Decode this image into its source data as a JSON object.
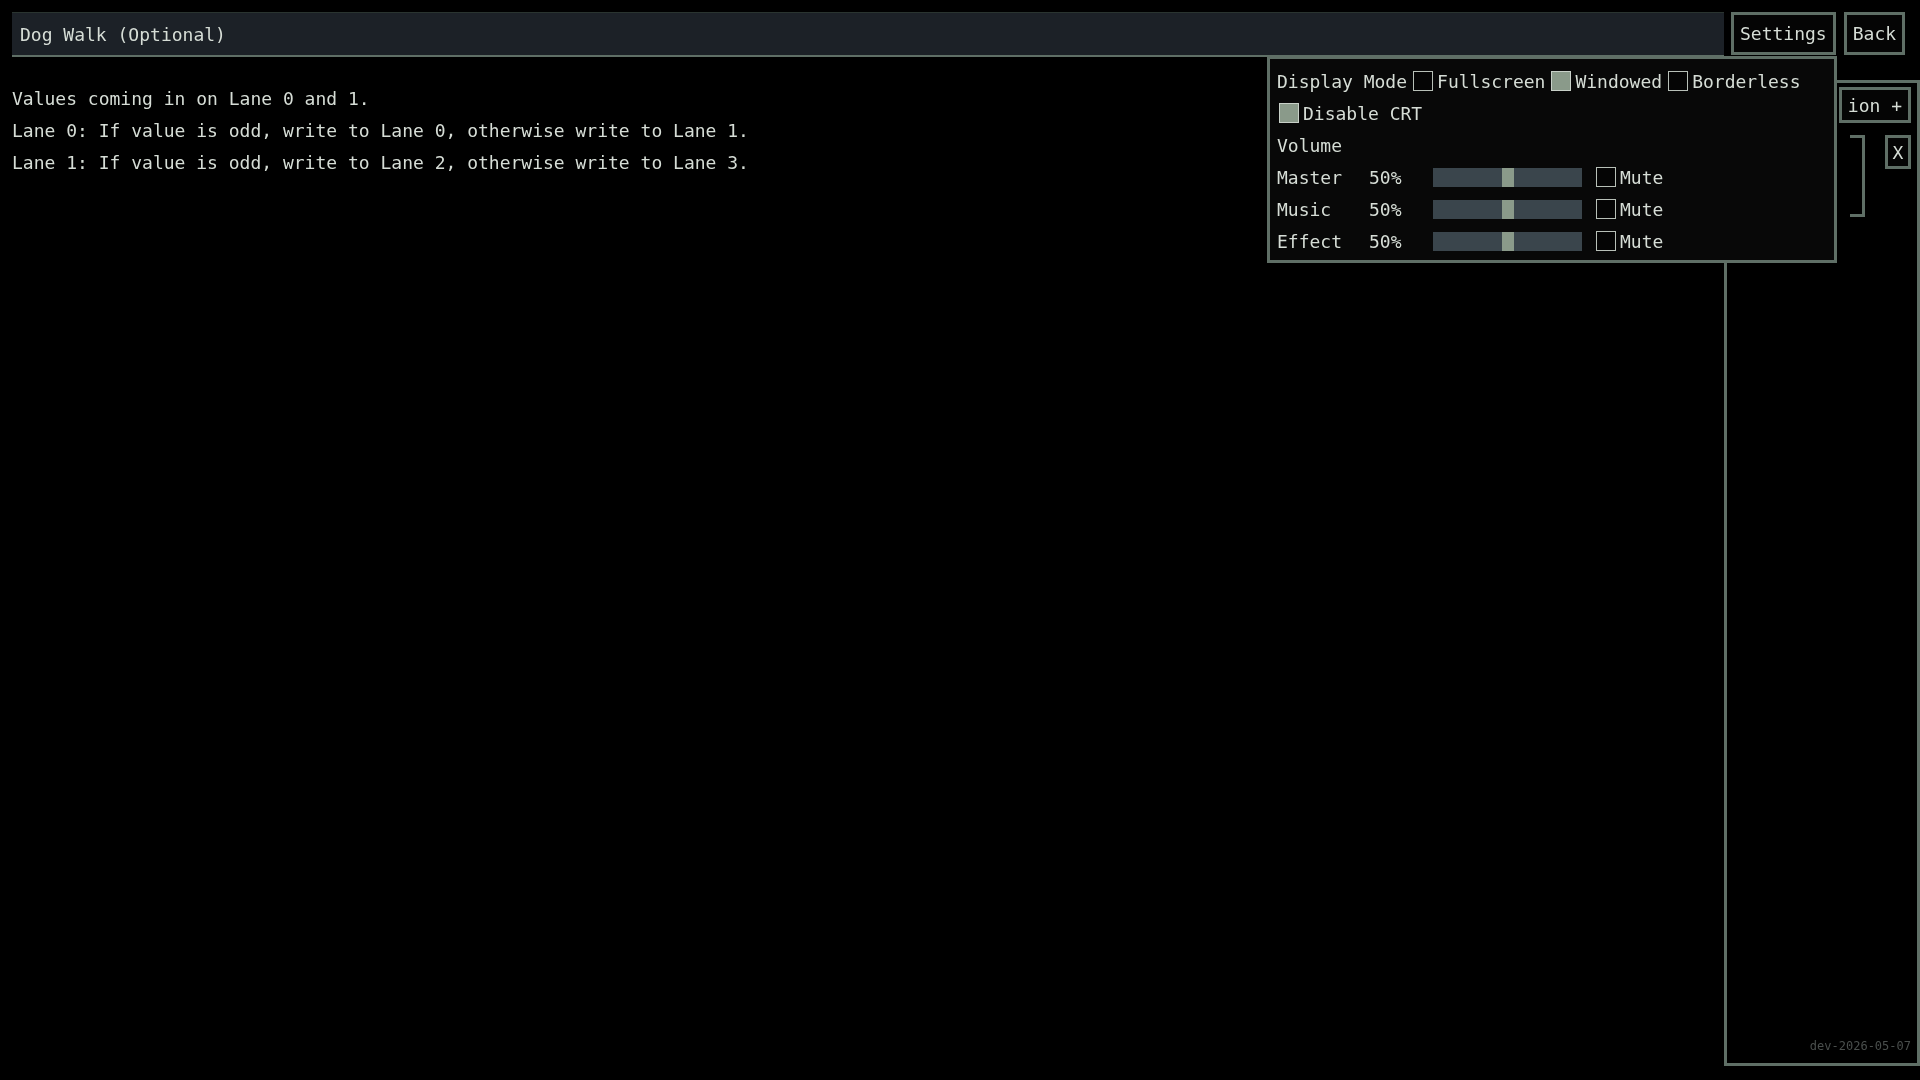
{
  "title_bar": {
    "title": "Dog Walk (Optional)"
  },
  "header_buttons": [
    {
      "label": "Settings"
    },
    {
      "label": "Back"
    }
  ],
  "description": [
    "Values coming in on Lane 0 and 1.",
    "Lane 0: If value is odd, write to Lane 0, otherwise write to Lane 1.",
    "Lane 1: If value is odd, write to Lane 2, otherwise write to Lane 3."
  ],
  "side_panel": {
    "add_button": "ion +",
    "remove_button": "X"
  },
  "settings": {
    "display_mode": {
      "label": "Display Mode",
      "options": [
        {
          "label": "Fullscreen",
          "selected": false
        },
        {
          "label": "Windowed",
          "selected": true
        },
        {
          "label": "Borderless",
          "selected": false
        }
      ]
    },
    "disable_crt": {
      "label": "Disable CRT",
      "checked": true
    },
    "volume_heading": "Volume",
    "channels": [
      {
        "name": "Master",
        "reading": "50%",
        "level": 0.5,
        "mute_label": "Mute",
        "muted": false
      },
      {
        "name": "Music",
        "reading": "50%",
        "level": 0.5,
        "mute_label": "Mute",
        "muted": false
      },
      {
        "name": "Effect",
        "reading": "50%",
        "level": 0.5,
        "mute_label": "Mute",
        "muted": false
      }
    ]
  },
  "version": "dev-2026-05-07"
}
